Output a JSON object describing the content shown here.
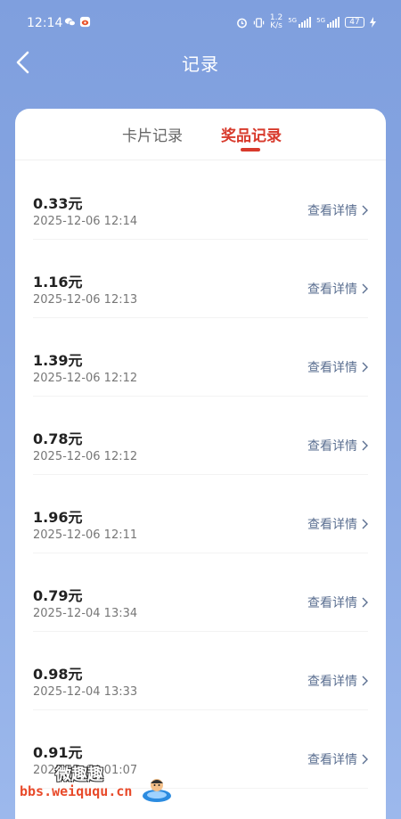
{
  "status_bar": {
    "time": "12:14",
    "net_speed_value": "1.2",
    "net_speed_unit": "K/s",
    "sim1_tag": "5G",
    "sim2_tag": "5G",
    "battery": "47"
  },
  "header": {
    "title": "记录"
  },
  "tabs": [
    {
      "label": "卡片记录",
      "active": false
    },
    {
      "label": "奖品记录",
      "active": true
    }
  ],
  "records": [
    {
      "amount": "0.33元",
      "time": "2025-12-06 12:14",
      "link": "查看详情"
    },
    {
      "amount": "1.16元",
      "time": "2025-12-06 12:13",
      "link": "查看详情"
    },
    {
      "amount": "1.39元",
      "time": "2025-12-06 12:12",
      "link": "查看详情"
    },
    {
      "amount": "0.78元",
      "time": "2025-12-06 12:12",
      "link": "查看详情"
    },
    {
      "amount": "1.96元",
      "time": "2025-12-06 12:11",
      "link": "查看详情"
    },
    {
      "amount": "0.79元",
      "time": "2025-12-04 13:34",
      "link": "查看详情"
    },
    {
      "amount": "0.98元",
      "time": "2025-12-04 13:33",
      "link": "查看详情"
    },
    {
      "amount": "0.91元",
      "time": "2025-12-04 01:07",
      "link": "查看详情"
    }
  ],
  "watermark": {
    "name": "微趣趣",
    "url": "bbs.weiququ.cn"
  },
  "colors": {
    "accent": "#d83a2c",
    "link": "#5b6f91",
    "background_top": "#7f9fde"
  }
}
